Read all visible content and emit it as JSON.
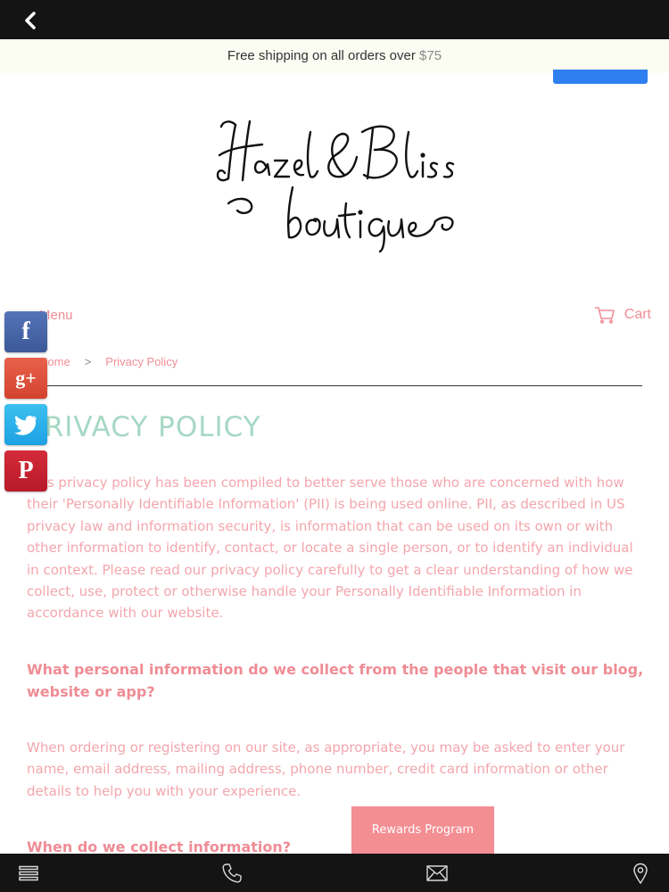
{
  "banner": {
    "text": "Free shipping on all orders over ",
    "price": "$75"
  },
  "logo": {
    "line1": "Hazel & Bliss",
    "line2": "boutique"
  },
  "nav": {
    "menu_label": "Menu",
    "cart_label": "Cart"
  },
  "breadcrumb": {
    "home": "Home",
    "separator": ">",
    "current": "Privacy Policy"
  },
  "page": {
    "title": "PRIVACY POLICY",
    "intro": "This privacy policy has been compiled to better serve those who are concerned with how their 'Personally Identifiable Information' (PII) is being used online. PII, as described in US privacy law and information security, is information that can be used on its own or with other information to identify, contact, or locate a single person, or to identify an individual in context. Please read our privacy policy carefully to get a clear understanding of how we collect, use, protect or otherwise handle your Personally Identifiable Information in accordance with our website.",
    "heading1": "What personal information do we collect from the people that visit our blog, website or app?",
    "para2": "When ordering or registering on our site, as appropriate, you may be asked to enter your name, email address, mailing address, phone number, credit card information or other details to help you with your experience.",
    "heading2": "When do we collect information?"
  },
  "rewards": {
    "label": "Rewards Program"
  },
  "social": {
    "facebook": "f",
    "google_plus": "g+",
    "twitter": "twitter-icon",
    "pinterest": "P"
  },
  "bottom_nav": {
    "icons": [
      "menu-icon",
      "phone-icon",
      "mail-icon",
      "location-icon"
    ]
  },
  "colors": {
    "accent_pink": "#f08e95",
    "title_mint": "#a6d8c4",
    "bar_dark": "#141414",
    "rewards_bg": "#f38e93"
  }
}
